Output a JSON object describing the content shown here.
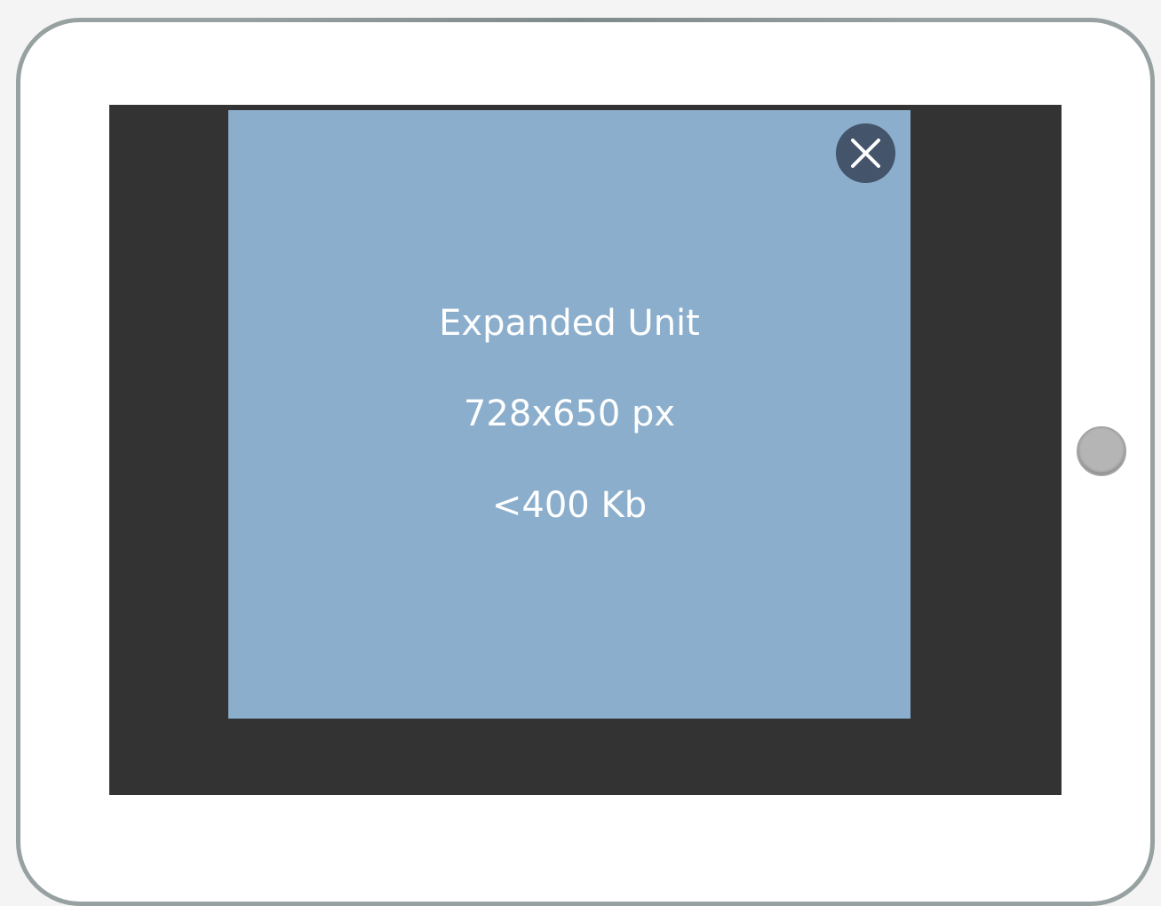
{
  "ad_unit": {
    "title": "Expanded Unit",
    "dimensions": "728x650 px",
    "file_size": "<400 Kb"
  },
  "icons": {
    "close": "close-icon",
    "home": "home-button"
  },
  "colors": {
    "ad_background": "#8aaecc",
    "screen_background": "#333333",
    "close_button": "#44546a",
    "device_bezel": "#ffffff",
    "device_border": "#98a1a1",
    "home_button": "#b5b5b5"
  }
}
